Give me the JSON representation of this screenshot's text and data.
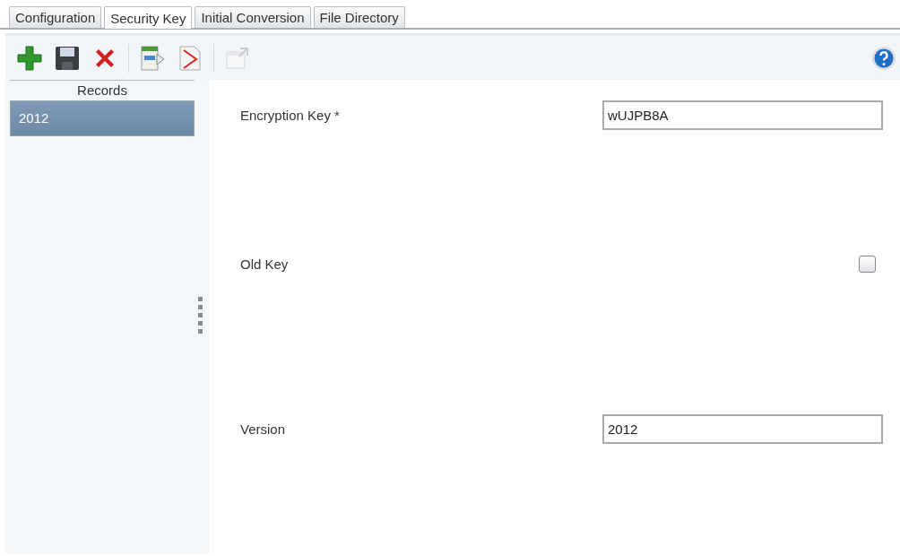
{
  "tabs": [
    {
      "label": "Configuration",
      "selected": false
    },
    {
      "label": "Security Key",
      "selected": true
    },
    {
      "label": "Initial Conversion",
      "selected": false
    },
    {
      "label": "File Directory",
      "selected": false
    }
  ],
  "toolbar": [
    {
      "kind": "add",
      "disabled": false
    },
    {
      "kind": "save",
      "disabled": false
    },
    {
      "kind": "delete",
      "disabled": false
    },
    {
      "kind": "separator"
    },
    {
      "kind": "export",
      "disabled": false
    },
    {
      "kind": "pdf",
      "disabled": false
    },
    {
      "kind": "separator"
    },
    {
      "kind": "popout",
      "disabled": true
    }
  ],
  "records": {
    "title": "Records",
    "items": [
      {
        "label": "2012",
        "selected": true
      }
    ]
  },
  "fields": [
    {
      "kind": "text",
      "label": "Encryption Key *",
      "value": "wUJPB8A"
    },
    {
      "kind": "checkbox",
      "label": "Old Key",
      "checked": false
    },
    {
      "kind": "text",
      "label": "Version",
      "value": "2012"
    }
  ]
}
